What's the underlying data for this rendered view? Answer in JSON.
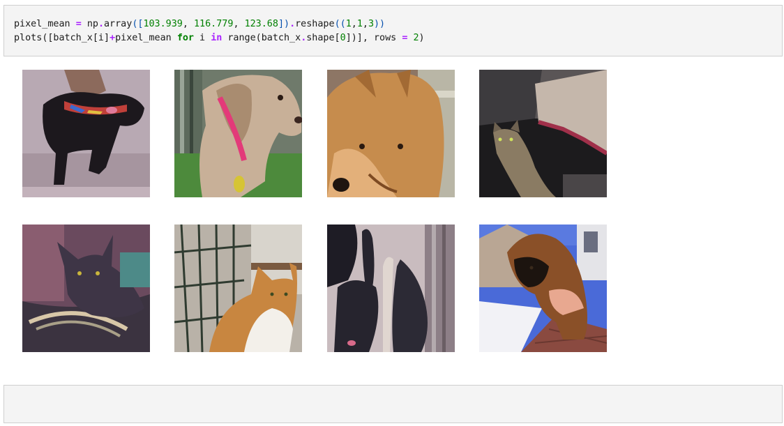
{
  "code_cell": {
    "line1": {
      "var": "pixel_mean",
      "eq": "=",
      "fn": "np",
      "dot1": ".",
      "array": "array",
      "open": "([",
      "n1": "103.939",
      "c1": ", ",
      "n2": "116.779",
      "c2": ", ",
      "n3": "123.68",
      "close": "])",
      "dot2": ".",
      "reshape": "reshape",
      "open2": "((",
      "a1": "1",
      "ac1": ",",
      "a2": "1",
      "ac2": ",",
      "a3": "3",
      "close2": "))"
    },
    "line2": {
      "fn": "plots",
      "open": "([batch_x[i]",
      "plus": "+",
      "mid": "pixel_mean ",
      "kw_for": "for",
      "var_i": " i ",
      "kw_in": "in",
      "rng": " range(batch_x",
      "dot": ".",
      "shape": "shape[",
      "zero": "0",
      "tail": "])], rows ",
      "eq": "=",
      "sp": " ",
      "two": "2",
      "end": ")"
    }
  },
  "images": [
    {
      "name": "image-black-dog",
      "subject": "black dog with rainbow collar"
    },
    {
      "name": "image-beagle-pink-collar",
      "subject": "hound dog with pink collar"
    },
    {
      "name": "image-fluffy-dog",
      "subject": "fluffy brown dog face"
    },
    {
      "name": "image-tabby-cat",
      "subject": "tabby cat on dark carpet"
    },
    {
      "name": "image-dark-cat",
      "subject": "dark cat lying on furniture"
    },
    {
      "name": "image-orange-white-cat",
      "subject": "orange and white cat by crate"
    },
    {
      "name": "image-black-puppies",
      "subject": "black puppies on snow"
    },
    {
      "name": "image-brown-puppy",
      "subject": "brown fluffy puppy held up"
    }
  ],
  "colors": {
    "cell_bg": "#f4f4f4",
    "cell_border": "#cfcfcf",
    "number": "#008000",
    "operator": "#aa22ff"
  }
}
